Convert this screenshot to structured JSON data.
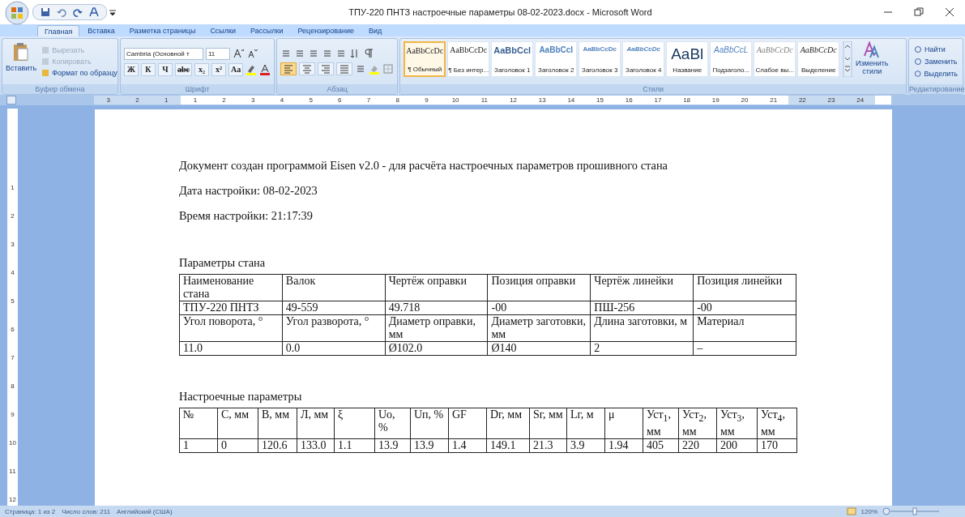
{
  "window": {
    "title": "ТПУ-220 ПНТЗ настроечные параметры 08-02-2023.docx - Microsoft Word"
  },
  "tabs": [
    {
      "label": "Главная",
      "selected": true
    },
    {
      "label": "Вставка",
      "selected": false
    },
    {
      "label": "Разметка страницы",
      "selected": false
    },
    {
      "label": "Ссылки",
      "selected": false
    },
    {
      "label": "Рассылки",
      "selected": false
    },
    {
      "label": "Рецензирование",
      "selected": false
    },
    {
      "label": "Вид",
      "selected": false
    }
  ],
  "clipboard": {
    "paste": "Вставить",
    "items": [
      {
        "label": "Вырезать",
        "disabled": true
      },
      {
        "label": "Копировать",
        "disabled": true
      },
      {
        "label": "Формат по образцу",
        "disabled": false
      }
    ],
    "group": "Буфер обмена"
  },
  "font": {
    "family": "Cambria (Основной т",
    "size": "11",
    "buttons": [
      "Ж",
      "К",
      "Ч",
      "abc",
      "x₂",
      "x²",
      "Aa"
    ],
    "group": "Шрифт"
  },
  "paragraph": {
    "align": [
      {
        "selected": true
      },
      {
        "selected": false
      },
      {
        "selected": false
      },
      {
        "selected": false
      }
    ],
    "group": "Абзац"
  },
  "styles": {
    "items": [
      {
        "preview": "AaBbCcDc",
        "name": "¶ Обычный",
        "kind": "normal",
        "selected": true
      },
      {
        "preview": "AaBbCcDc",
        "name": "¶ Без интер...",
        "kind": "normal",
        "selected": false
      },
      {
        "preview": "AaBbCcl",
        "name": "Заголовок 1",
        "kind": "heading1",
        "selected": false
      },
      {
        "preview": "AaBbCcI",
        "name": "Заголовок 2",
        "kind": "heading2",
        "selected": false
      },
      {
        "preview": "AaBbCcDc",
        "name": "Заголовок 3",
        "kind": "heading3",
        "selected": false
      },
      {
        "preview": "AaBbCcDc",
        "name": "Заголовок 4",
        "kind": "heading4",
        "selected": false
      },
      {
        "preview": "AaBl",
        "name": "Название",
        "kind": "title",
        "selected": false
      },
      {
        "preview": "AaBbCcL",
        "name": "Подзаголо...",
        "kind": "subtitle",
        "selected": false
      },
      {
        "preview": "AaBbCcDc",
        "name": "Слабое вы...",
        "kind": "subtle",
        "selected": false
      },
      {
        "preview": "AaBbCcDc",
        "name": "Выделение",
        "kind": "emphasis",
        "selected": false
      }
    ],
    "change": "Изменить стили",
    "group": "Стили"
  },
  "editing": {
    "items": [
      "Найти",
      "Заменить",
      "Выделить"
    ],
    "group": "Редактирование"
  },
  "ruler": {
    "labels": [
      "3",
      "2",
      "1",
      "1",
      "2",
      "3",
      "4",
      "5",
      "6",
      "7",
      "8",
      "9",
      "10",
      "11",
      "12",
      "13",
      "14",
      "15",
      "16",
      "17",
      "18",
      "19",
      "20",
      "21",
      "22",
      "23",
      "24"
    ],
    "vertical": [
      "1",
      "2",
      "3",
      "4",
      "5",
      "6",
      "7",
      "8",
      "9",
      "10",
      "11",
      "12"
    ]
  },
  "document": {
    "paragraphs": [
      "Документ создан программой Eisen v2.0 - для расчёта настроечных параметров прошивного стана",
      "Дата настройки: 08-02-2023",
      "Время настройки: 21:17:39"
    ],
    "sections": [
      {
        "heading": "Параметры стана",
        "table": {
          "rows": [
            [
              "Наименование стана",
              "Валок",
              "Чертёж оправки",
              "Позиция оправки",
              "Чертёж линейки",
              "Позиция линейки"
            ],
            [
              "ТПУ-220 ПНТЗ",
              "49-559",
              "49.718",
              "-00",
              "ПШ-256",
              "-00"
            ],
            [
              "Угол поворота, °",
              "Угол разворота, °",
              "Диаметр оправки, мм",
              "Диаметр заготовки, мм",
              "Длина заготовки, м",
              "Материал"
            ],
            [
              "11.0",
              "0.0",
              "Ø102.0",
              "Ø140",
              "2",
              "–"
            ]
          ]
        }
      },
      {
        "heading": "Настроечные параметры",
        "table": {
          "rows": [
            [
              "№",
              "С, мм",
              "В, мм",
              "Л, мм",
              "ξ",
              "Uо, %",
              "Uп, %",
              "GF",
              "Dг, мм",
              "Sг, мм",
              "Lг, м",
              "μ",
              "Уст$_{1}$, мм",
              "Уст$_{2}$, мм",
              "Уст$_{3}$, мм",
              "Уст$_{4}$, мм"
            ],
            [
              "1",
              "0",
              "120.6",
              "133.0",
              "1.1",
              "13.9",
              "13.9",
              "1.4",
              "149.1",
              "21.3",
              "3.9",
              "1.94",
              "405",
              "220",
              "200",
              "170"
            ]
          ]
        }
      }
    ]
  },
  "status_bar": {
    "items": [
      "Страница: 1 из 2",
      "Число слов: 211",
      "Английский (США)"
    ],
    "zoom": "120%"
  }
}
